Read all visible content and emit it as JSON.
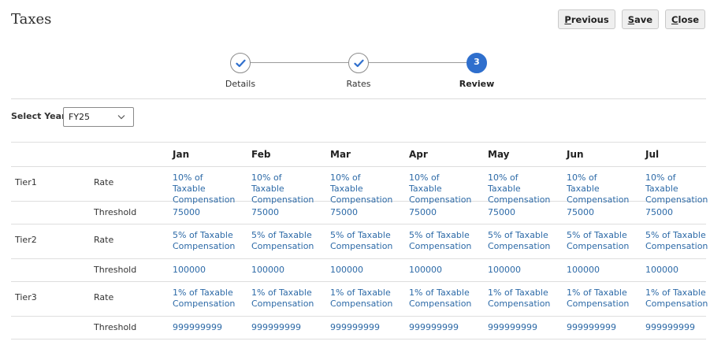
{
  "header": {
    "title": "Taxes",
    "buttons": {
      "previous": {
        "first": "P",
        "rest": "revious"
      },
      "save": {
        "first": "S",
        "rest": "ave"
      },
      "close": {
        "first": "C",
        "rest": "lose"
      }
    }
  },
  "train": {
    "steps": [
      {
        "label": "Details",
        "state": "complete"
      },
      {
        "label": "Rates",
        "state": "complete"
      },
      {
        "label": "Review",
        "state": "current",
        "number": "3"
      }
    ],
    "accent_color": "#2f6fcd"
  },
  "year_select": {
    "label": "Select Year:",
    "value": "FY25"
  },
  "grid": {
    "months": [
      "Jan",
      "Feb",
      "Mar",
      "Apr",
      "May",
      "Jun",
      "Jul"
    ],
    "rows": [
      {
        "tier": "Tier1",
        "attribute": "Rate",
        "values": [
          "10% of Taxable Compensation",
          "10% of Taxable Compensation",
          "10% of Taxable Compensation",
          "10% of Taxable Compensation",
          "10% of Taxable Compensation",
          "10% of Taxable Compensation",
          "10% of Taxable Compensation"
        ]
      },
      {
        "tier": "",
        "attribute": "Threshold",
        "values": [
          "75000",
          "75000",
          "75000",
          "75000",
          "75000",
          "75000",
          "75000"
        ]
      },
      {
        "tier": "Tier2",
        "attribute": "Rate",
        "values": [
          "5% of Taxable Compensation",
          "5% of Taxable Compensation",
          "5% of Taxable Compensation",
          "5% of Taxable Compensation",
          "5% of Taxable Compensation",
          "5% of Taxable Compensation",
          "5% of Taxable Compensation"
        ]
      },
      {
        "tier": "",
        "attribute": "Threshold",
        "values": [
          "100000",
          "100000",
          "100000",
          "100000",
          "100000",
          "100000",
          "100000"
        ]
      },
      {
        "tier": "Tier3",
        "attribute": "Rate",
        "values": [
          "1% of Taxable Compensation",
          "1% of Taxable Compensation",
          "1% of Taxable Compensation",
          "1% of Taxable Compensation",
          "1% of Taxable Compensation",
          "1% of Taxable Compensation",
          "1% of Taxable Compensation"
        ]
      },
      {
        "tier": "",
        "attribute": "Threshold",
        "values": [
          "999999999",
          "999999999",
          "999999999",
          "999999999",
          "999999999",
          "999999999",
          "999999999"
        ]
      }
    ],
    "value_color": "#2d6aa7"
  }
}
